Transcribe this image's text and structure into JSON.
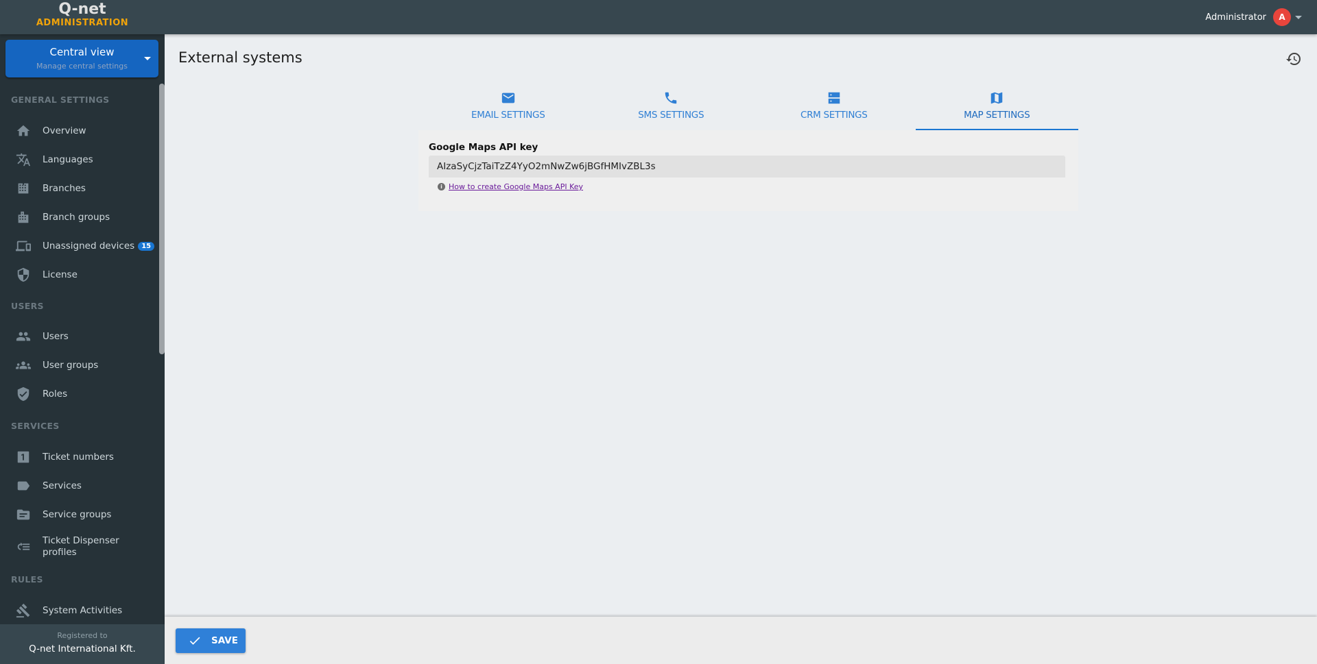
{
  "header": {
    "logo_main": "Q-net",
    "logo_sub": "ADMINISTRATION",
    "user_name": "Administrator",
    "avatar_initial": "A"
  },
  "sidebar": {
    "central_view": {
      "title": "Central view",
      "subtitle": "Manage central settings"
    },
    "sections": [
      {
        "title": "GENERAL SETTINGS"
      },
      {
        "title": "USERS"
      },
      {
        "title": "SERVICES"
      },
      {
        "title": "RULES"
      }
    ],
    "items": [
      {
        "label": "Overview",
        "icon": "home-icon"
      },
      {
        "label": "Languages",
        "icon": "translate-icon"
      },
      {
        "label": "Branches",
        "icon": "building-icon"
      },
      {
        "label": "Branch groups",
        "icon": "buildings-icon"
      },
      {
        "label": "Unassigned devices",
        "icon": "devices-icon",
        "badge": "15"
      },
      {
        "label": "License",
        "icon": "shield-icon"
      },
      {
        "label": "Users",
        "icon": "users-icon"
      },
      {
        "label": "User groups",
        "icon": "user-groups-icon"
      },
      {
        "label": "Roles",
        "icon": "shield-check-icon"
      },
      {
        "label": "Ticket numbers",
        "icon": "ticket-number-icon"
      },
      {
        "label": "Services",
        "icon": "label-icon"
      },
      {
        "label": "Service groups",
        "icon": "folder-icon"
      },
      {
        "label": "Ticket Dispenser profiles",
        "icon": "list-return-icon"
      },
      {
        "label": "System Activities",
        "icon": "gavel-icon"
      }
    ],
    "registered_label": "Registered to",
    "registered_name": "Q-net International Kft."
  },
  "main": {
    "title": "External systems",
    "tabs": [
      {
        "label": "EMAIL SETTINGS",
        "icon": "email-icon",
        "active": false
      },
      {
        "label": "SMS SETTINGS",
        "icon": "phone-icon",
        "active": false
      },
      {
        "label": "CRM SETTINGS",
        "icon": "server-icon",
        "active": false
      },
      {
        "label": "MAP SETTINGS",
        "icon": "map-icon",
        "active": true
      }
    ],
    "map": {
      "field_label": "Google Maps API key",
      "api_key": "AIzaSyCjzTaiTzZ4YyO2mNwZw6jBGfHMIvZBL3s",
      "help_link": "How to create Google Maps API Key"
    }
  },
  "footer": {
    "save_label": "SAVE"
  },
  "colors": {
    "accent": "#1976d2",
    "sidebar_bg": "#263238",
    "topbar_bg": "#37474f",
    "logo_accent": "#f0a30a",
    "avatar": "#e8453c"
  }
}
